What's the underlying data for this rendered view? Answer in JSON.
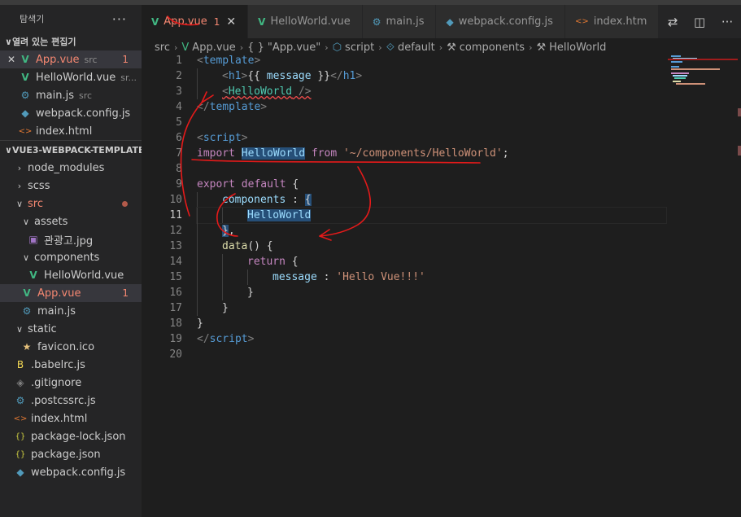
{
  "sidebar": {
    "title": "탐색기",
    "more_label": "···",
    "open_editors_title": "열려 있는 편집기",
    "open_editors": [
      {
        "name": "App.vue",
        "sub": "src",
        "badge": "1",
        "icon": "vue-icon",
        "active": true,
        "error": true
      },
      {
        "name": "HelloWorld.vue",
        "sub": "sr...",
        "icon": "vue-icon"
      },
      {
        "name": "main.js",
        "sub": "src",
        "icon": "js-icon"
      },
      {
        "name": "webpack.config.js",
        "sub": "",
        "icon": "webpack-icon"
      },
      {
        "name": "index.html",
        "sub": "",
        "icon": "html-icon"
      }
    ],
    "project_title": "VUE3-WEBPACK-TEMPLATE",
    "tree": [
      {
        "name": "node_modules",
        "type": "folder",
        "depth": 0,
        "open": false
      },
      {
        "name": "scss",
        "type": "folder",
        "depth": 0,
        "open": false
      },
      {
        "name": "src",
        "type": "folder",
        "depth": 0,
        "open": true,
        "error": true,
        "dot": true
      },
      {
        "name": "assets",
        "type": "folder",
        "depth": 1,
        "open": true
      },
      {
        "name": "관광고.jpg",
        "type": "image",
        "depth": 2
      },
      {
        "name": "components",
        "type": "folder",
        "depth": 1,
        "open": true
      },
      {
        "name": "HelloWorld.vue",
        "type": "vue",
        "depth": 2
      },
      {
        "name": "App.vue",
        "type": "vue",
        "depth": 1,
        "error": true,
        "badge": "1",
        "active": true
      },
      {
        "name": "main.js",
        "type": "js",
        "depth": 1
      },
      {
        "name": "static",
        "type": "folder",
        "depth": 0,
        "open": true
      },
      {
        "name": "favicon.ico",
        "type": "star",
        "depth": 1
      },
      {
        "name": ".babelrc.js",
        "type": "babel",
        "depth": 0
      },
      {
        "name": ".gitignore",
        "type": "git",
        "depth": 0
      },
      {
        "name": ".postcssrc.js",
        "type": "js",
        "depth": 0
      },
      {
        "name": "index.html",
        "type": "html",
        "depth": 0
      },
      {
        "name": "package-lock.json",
        "type": "json",
        "depth": 0
      },
      {
        "name": "package.json",
        "type": "json",
        "depth": 0
      },
      {
        "name": "webpack.config.js",
        "type": "webpack",
        "depth": 0
      }
    ]
  },
  "tabs": [
    {
      "label": "App.vue",
      "badge": "1",
      "icon": "vue-icon",
      "active": true
    },
    {
      "label": "HelloWorld.vue",
      "icon": "vue-icon"
    },
    {
      "label": "main.js",
      "icon": "js-icon"
    },
    {
      "label": "webpack.config.js",
      "icon": "webpack-icon"
    },
    {
      "label": "index.htm",
      "icon": "html-icon"
    }
  ],
  "breadcrumb": [
    "src",
    "App.vue",
    "\"App.vue\"",
    "script",
    "default",
    "components",
    "HelloWorld"
  ],
  "editor": {
    "line_numbers": [
      "1",
      "2",
      "3",
      "4",
      "5",
      "6",
      "7",
      "8",
      "9",
      "10",
      "11",
      "12",
      "13",
      "14",
      "15",
      "16",
      "17",
      "18",
      "19",
      "20"
    ],
    "current_line": "11",
    "lines": [
      [
        [
          "tag",
          "<"
        ],
        [
          "name",
          "template"
        ],
        [
          "tag",
          ">"
        ]
      ],
      [
        [
          "ind",
          ""
        ],
        [
          "tag",
          "<"
        ],
        [
          "name",
          "h1"
        ],
        [
          "tag",
          ">"
        ],
        [
          "txt",
          "{{ "
        ],
        [
          "prop",
          "message"
        ],
        [
          "txt",
          " }}"
        ],
        [
          "tag",
          "</"
        ],
        [
          "name",
          "h1"
        ],
        [
          "tag",
          ">"
        ]
      ],
      [
        [
          "ind",
          ""
        ],
        [
          "squigtag",
          "<"
        ],
        [
          "squigcomp",
          "HelloWorld"
        ],
        [
          "squigtag",
          " />"
        ]
      ],
      [
        [
          "tag",
          "</"
        ],
        [
          "name",
          "template"
        ],
        [
          "tag",
          ">"
        ]
      ],
      [],
      [
        [
          "tag",
          "<"
        ],
        [
          "name",
          "script"
        ],
        [
          "tag",
          ">"
        ]
      ],
      [
        [
          "kw",
          "import "
        ],
        [
          "hlprop",
          "HelloWorld"
        ],
        [
          "kw",
          " from "
        ],
        [
          "str",
          "'~/components/HelloWorld'"
        ],
        [
          "txt",
          ";"
        ]
      ],
      [],
      [
        [
          "kw",
          "export default "
        ],
        [
          "txt",
          "{"
        ]
      ],
      [
        [
          "ind",
          ""
        ],
        [
          "prop",
          "components"
        ],
        [
          "txt",
          " : "
        ],
        [
          "hltxt",
          "{"
        ]
      ],
      [
        [
          "ind",
          ""
        ],
        [
          "ind",
          ""
        ],
        [
          "hlprop",
          "HelloWorld"
        ]
      ],
      [
        [
          "ind",
          ""
        ],
        [
          "hltxt",
          "}"
        ],
        [
          "txt",
          ","
        ]
      ],
      [
        [
          "ind",
          ""
        ],
        [
          "fn",
          "data"
        ],
        [
          "txt",
          "() {"
        ]
      ],
      [
        [
          "ind",
          ""
        ],
        [
          "ind",
          ""
        ],
        [
          "kw",
          "return "
        ],
        [
          "txt",
          "{"
        ]
      ],
      [
        [
          "ind",
          ""
        ],
        [
          "ind",
          ""
        ],
        [
          "ind",
          ""
        ],
        [
          "prop",
          "message"
        ],
        [
          "txt",
          " : "
        ],
        [
          "str",
          "'Hello Vue!!!'"
        ]
      ],
      [
        [
          "ind",
          ""
        ],
        [
          "ind",
          ""
        ],
        [
          "txt",
          "}"
        ]
      ],
      [
        [
          "ind",
          ""
        ],
        [
          "txt",
          "}"
        ]
      ],
      [
        [
          "txt",
          "}"
        ]
      ],
      [
        [
          "tag",
          "</"
        ],
        [
          "name",
          "script"
        ],
        [
          "tag",
          ">"
        ]
      ],
      []
    ]
  },
  "colors": {
    "error": "#f48771",
    "vue": "#41b883",
    "annotation": "#e51a1a",
    "selection": "#264f78"
  }
}
